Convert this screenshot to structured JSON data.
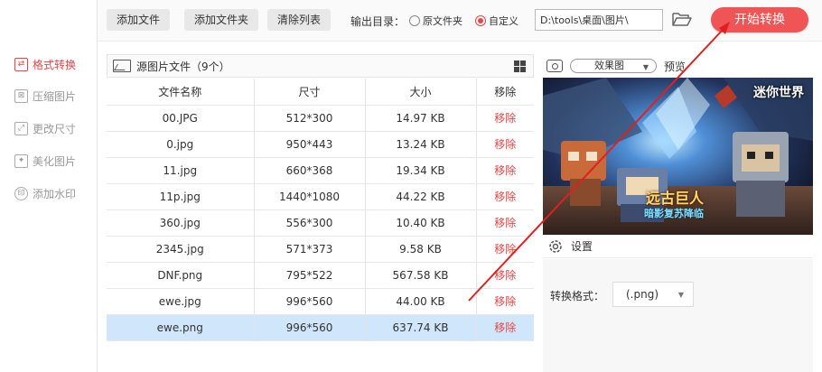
{
  "sidebar": {
    "items": [
      {
        "label": "格式转换",
        "icon": "format-convert-icon",
        "glyph": "⇄",
        "active": true
      },
      {
        "label": "压缩图片",
        "icon": "compress-icon",
        "glyph": "⊠",
        "active": false
      },
      {
        "label": "更改尺寸",
        "icon": "resize-icon",
        "glyph": "⤢",
        "active": false
      },
      {
        "label": "美化图片",
        "icon": "beautify-icon",
        "glyph": "✦",
        "active": false
      },
      {
        "label": "添加水印",
        "icon": "watermark-icon",
        "glyph": "印",
        "active": false
      }
    ]
  },
  "toolbar": {
    "add_file": "添加文件",
    "add_folder": "添加文件夹",
    "clear_list": "清除列表",
    "output_label": "输出目录：",
    "radio_original": "原文件夹",
    "radio_custom": "自定义",
    "output_path": "D:\\tools\\桌面\\图片\\",
    "start": "开始转换"
  },
  "filelist": {
    "title": "源图片文件（9个）",
    "columns": [
      "文件名称",
      "尺寸",
      "大小",
      "移除"
    ],
    "rows": [
      {
        "name": "00.JPG",
        "size": "512*300",
        "filesize": "14.97 KB",
        "remove": "移除"
      },
      {
        "name": "0.jpg",
        "size": "950*443",
        "filesize": "13.24 KB",
        "remove": "移除"
      },
      {
        "name": "11.jpg",
        "size": "660*368",
        "filesize": "19.34 KB",
        "remove": "移除"
      },
      {
        "name": "11p.jpg",
        "size": "1440*1080",
        "filesize": "44.22 KB",
        "remove": "移除"
      },
      {
        "name": "360.jpg",
        "size": "556*300",
        "filesize": "10.40 KB",
        "remove": "移除"
      },
      {
        "name": "2345.jpg",
        "size": "571*373",
        "filesize": "9.58 KB",
        "remove": "移除"
      },
      {
        "name": "DNF.png",
        "size": "795*522",
        "filesize": "567.58 KB",
        "remove": "移除"
      },
      {
        "name": "ewe.jpg",
        "size": "996*560",
        "filesize": "44.00 KB",
        "remove": "移除"
      },
      {
        "name": "ewe.png",
        "size": "996*560",
        "filesize": "637.74 KB",
        "remove": "移除",
        "selected": true
      }
    ]
  },
  "preview": {
    "effect_select": "效果图",
    "label": "预览",
    "game_title": "迷你世界",
    "banner_text": "远古巨人",
    "banner_sub": "暗影复苏降临"
  },
  "settings": {
    "title": "设置",
    "format_label": "转换格式：",
    "format_value": "(.png)"
  },
  "colors": {
    "accent": "#e84545",
    "start_button": "#f05555",
    "selected_row": "#cfe6fb"
  }
}
